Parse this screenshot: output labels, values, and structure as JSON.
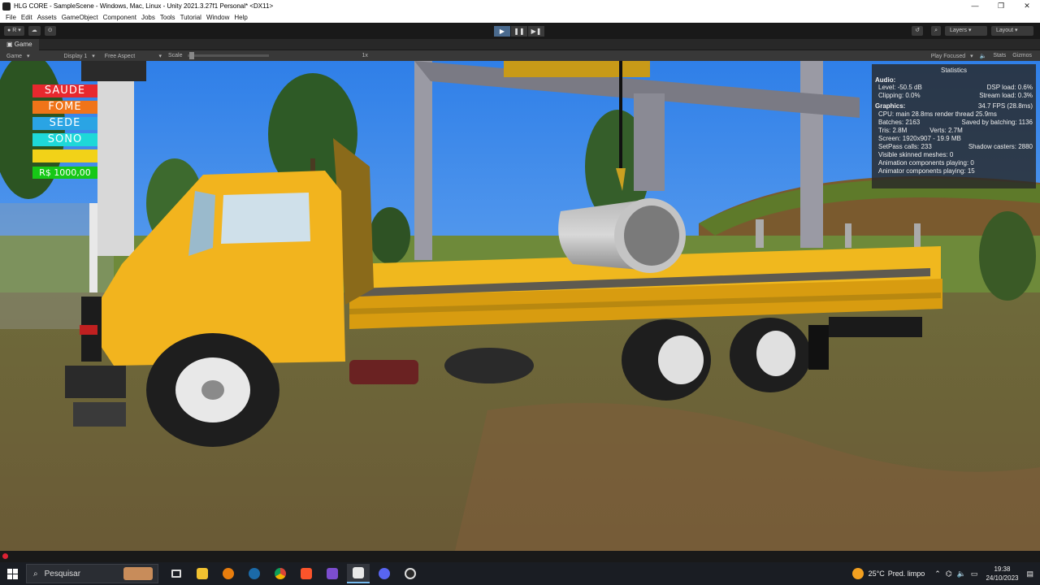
{
  "window": {
    "title": "HLG CORE - SampleScene - Windows, Mac, Linux - Unity 2021.3.27f1 Personal* <DX11>",
    "controls": [
      "—",
      "❐",
      "✕"
    ]
  },
  "menu": [
    "File",
    "Edit",
    "Assets",
    "GameObject",
    "Component",
    "Jobs",
    "Tools",
    "Tutorial",
    "Window",
    "Help"
  ],
  "toolbar": {
    "account": "R",
    "layers": "Layers",
    "layout": "Layout"
  },
  "game_view": {
    "tab": "Game",
    "mode": "Game",
    "display": "Display 1",
    "aspect": "Free Aspect",
    "scale_label": "Scale",
    "scale_value": "1x",
    "play_focused": "Play Focused",
    "stats_label": "Stats",
    "gizmos_label": "Gizmos"
  },
  "hud": {
    "bars": [
      {
        "label": "SAUDE",
        "color": "#e8282e"
      },
      {
        "label": "FOME",
        "color": "#f07418"
      },
      {
        "label": "SEDE",
        "color": "#2aa4e4"
      },
      {
        "label": "SONO",
        "color": "#1ed8d8"
      },
      {
        "label": "",
        "color": "#f2d218"
      }
    ],
    "money": "R$ 1000,00"
  },
  "statistics": {
    "title": "Statistics",
    "audio_header": "Audio:",
    "level": "Level: -50.5 dB",
    "dsp_load": "DSP load: 0.6%",
    "clipping": "Clipping: 0.0%",
    "stream_load": "Stream load: 0.3%",
    "graphics_header": "Graphics:",
    "fps": "34.7 FPS (28.8ms)",
    "cpu": "CPU: main 28.8ms  render thread 25.9ms",
    "batches": "Batches: 2163",
    "saved_batching": "Saved by batching: 1136",
    "tris": "Tris: 2.8M",
    "verts": "Verts: 2.7M",
    "screen": "Screen: 1920x907 - 19.9 MB",
    "setpass": "SetPass calls: 233",
    "shadow_casters": "Shadow casters: 2880",
    "skinned_meshes": "Visible skinned meshes: 0",
    "animation_components": "Animation components playing: 0",
    "animator_components": "Animator components playing: 15"
  },
  "taskbar": {
    "search_placeholder": "Pesquisar",
    "weather_temp": "25°C",
    "weather_desc": "Pred. limpo",
    "time": "19:38",
    "date": "24/10/2023"
  },
  "colors": {
    "truck_yellow": "#f0b81e",
    "sky": "#3c8cf0",
    "ground": "#7a6a3c"
  }
}
